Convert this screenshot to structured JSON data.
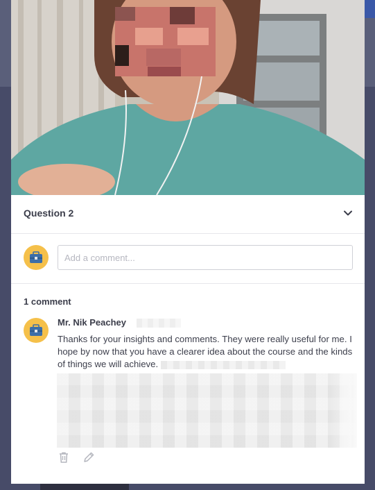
{
  "question": {
    "title": "Question 2"
  },
  "composer": {
    "placeholder": "Add a comment..."
  },
  "comments": {
    "count_label": "1 comment",
    "items": [
      {
        "author": "Mr. Nik Peachey",
        "text": "Thanks for your insights and comments. They were really useful for me. I hope by now that you have a clearer idea about the course and the kinds of things we will achieve."
      }
    ]
  },
  "icons": {
    "toggle": "chevron-down-icon",
    "avatar": "briefcase-icon",
    "delete": "trash-icon",
    "edit": "pencil-icon"
  },
  "colors": {
    "avatar_bg": "#f5c04a",
    "briefcase": "#3c6ea8",
    "text": "#3b3d4a",
    "overlay": "#474b68"
  }
}
